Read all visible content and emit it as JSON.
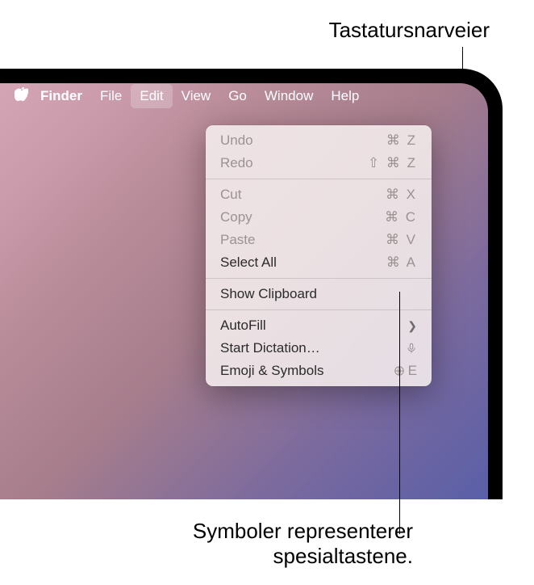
{
  "annotations": {
    "top": "Tastatursnarveier",
    "bottom_line1": "Symboler representerer",
    "bottom_line2": "spesialtastene."
  },
  "menubar": {
    "app": "Finder",
    "items": [
      "File",
      "Edit",
      "View",
      "Go",
      "Window",
      "Help"
    ]
  },
  "menu": {
    "undo": {
      "label": "Undo",
      "shortcut": "⌘ Z"
    },
    "redo": {
      "label": "Redo",
      "shortcut": "⇧ ⌘ Z"
    },
    "cut": {
      "label": "Cut",
      "shortcut": "⌘ X"
    },
    "copy": {
      "label": "Copy",
      "shortcut": "⌘ C"
    },
    "paste": {
      "label": "Paste",
      "shortcut": "⌘ V"
    },
    "select_all": {
      "label": "Select All",
      "shortcut": "⌘ A"
    },
    "show_clipboard": {
      "label": "Show Clipboard"
    },
    "autofill": {
      "label": "AutoFill"
    },
    "start_dictation": {
      "label": "Start Dictation…"
    },
    "emoji_symbols": {
      "label": "Emoji & Symbols",
      "shortcut_letter": "E"
    }
  }
}
